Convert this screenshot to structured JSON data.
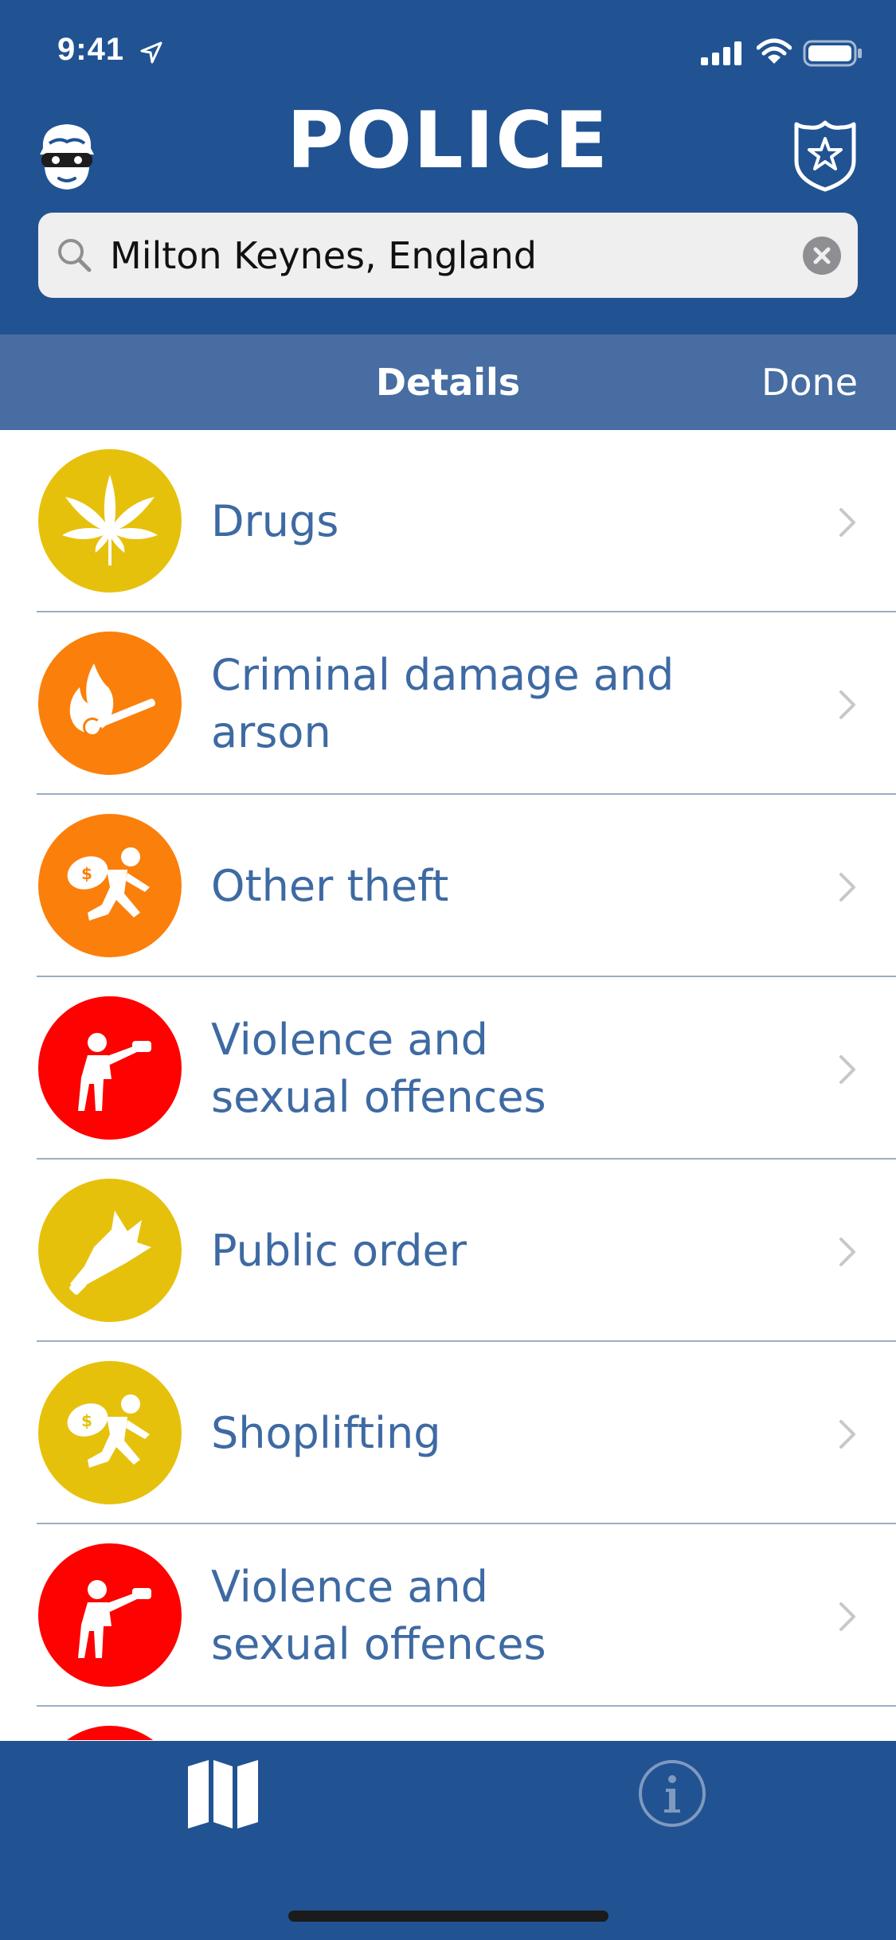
{
  "status_bar": {
    "time": "9:41"
  },
  "header": {
    "title": "POLICE"
  },
  "search": {
    "value": "Milton Keynes, England",
    "placeholder": ""
  },
  "subnav": {
    "title": "Details",
    "done_label": "Done"
  },
  "colors": {
    "header_blue": "#215393",
    "subnav_blue": "#476da2",
    "label_blue": "#3e6aa3",
    "yellow": "#e6c10c",
    "orange": "#fb7f0b",
    "red": "#fd0200"
  },
  "crimes": [
    {
      "label": "Drugs",
      "icon": "cannabis-leaf-icon",
      "color": "yellow"
    },
    {
      "label": "Criminal damage and arson",
      "icon": "match-flame-icon",
      "color": "orange"
    },
    {
      "label": "Other theft",
      "icon": "running-thief-icon",
      "color": "orange"
    },
    {
      "label_line1": "Violence and",
      "label_line2": "sexual offences",
      "icon": "fighting-person-icon",
      "color": "red"
    },
    {
      "label": "Public order",
      "icon": "broken-bottle-icon",
      "color": "yellow"
    },
    {
      "label": "Shoplifting",
      "icon": "running-thief-icon",
      "color": "yellow"
    },
    {
      "label_line1": "Violence and",
      "label_line2": "sexual offences",
      "icon": "fighting-person-icon",
      "color": "red"
    }
  ],
  "tabbar": {
    "tabs": [
      {
        "icon": "map-icon"
      },
      {
        "icon": "info-icon"
      }
    ]
  }
}
